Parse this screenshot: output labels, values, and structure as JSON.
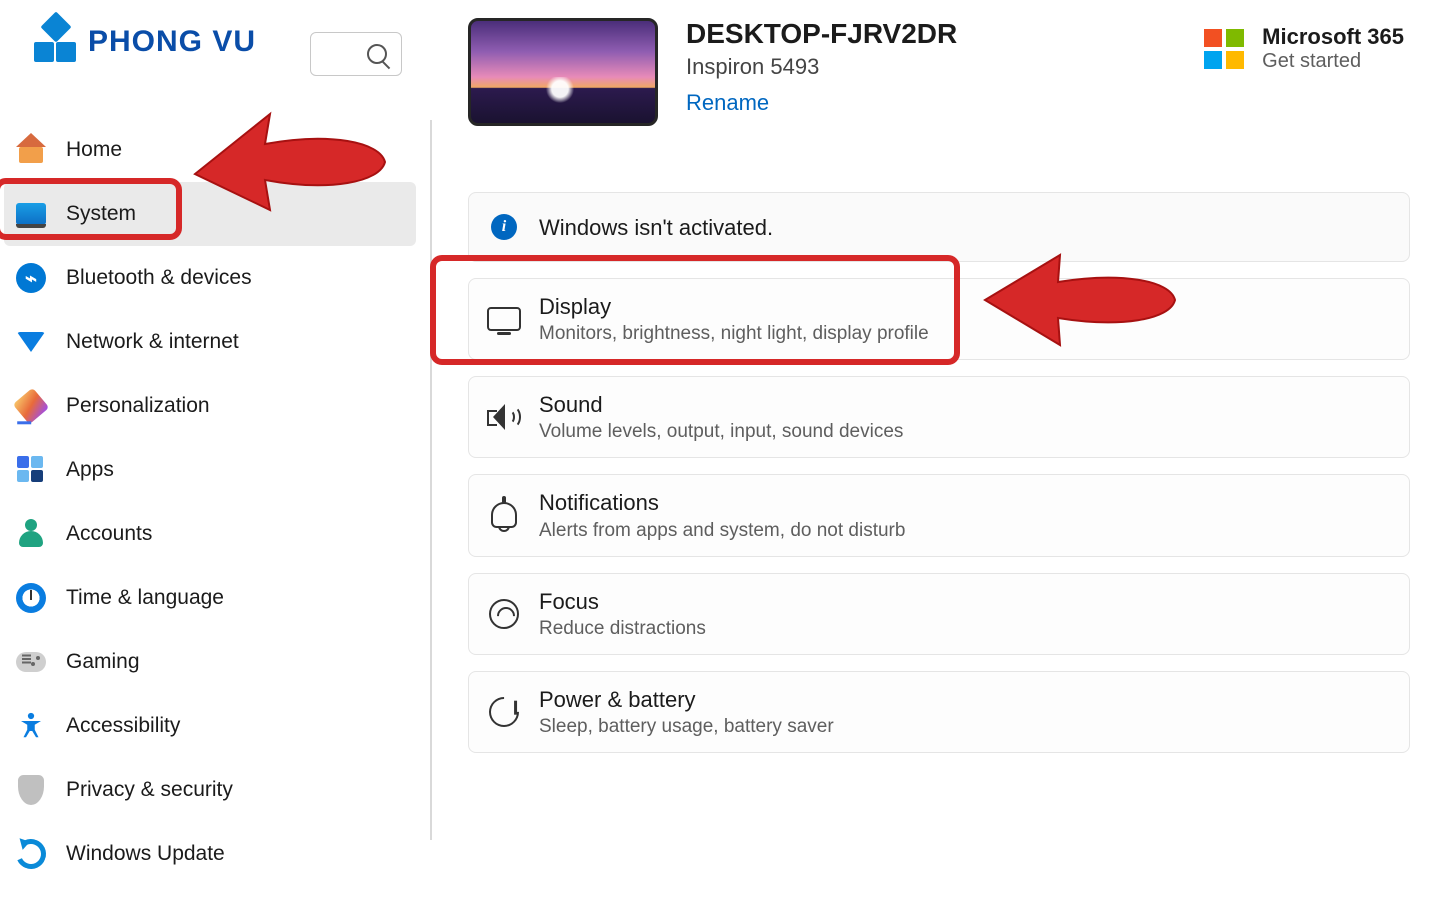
{
  "brand": {
    "name": "PHONG VU"
  },
  "sidebar": {
    "items": [
      {
        "label": "Home"
      },
      {
        "label": "System"
      },
      {
        "label": "Bluetooth & devices"
      },
      {
        "label": "Network & internet"
      },
      {
        "label": "Personalization"
      },
      {
        "label": "Apps"
      },
      {
        "label": "Accounts"
      },
      {
        "label": "Time & language"
      },
      {
        "label": "Gaming"
      },
      {
        "label": "Accessibility"
      },
      {
        "label": "Privacy & security"
      },
      {
        "label": "Windows Update"
      }
    ],
    "selected_index": 1
  },
  "header": {
    "device_name": "DESKTOP-FJRV2DR",
    "device_model": "Inspiron 5493",
    "rename": "Rename",
    "ms365_title": "Microsoft 365",
    "ms365_sub": "Get started"
  },
  "activation": {
    "text": "Windows isn't activated."
  },
  "cards": [
    {
      "title": "Display",
      "sub": "Monitors, brightness, night light, display profile"
    },
    {
      "title": "Sound",
      "sub": "Volume levels, output, input, sound devices"
    },
    {
      "title": "Notifications",
      "sub": "Alerts from apps and system, do not disturb"
    },
    {
      "title": "Focus",
      "sub": "Reduce distractions"
    },
    {
      "title": "Power & battery",
      "sub": "Sleep, battery usage, battery saver"
    }
  ],
  "colors": {
    "annotation": "#d62828"
  }
}
